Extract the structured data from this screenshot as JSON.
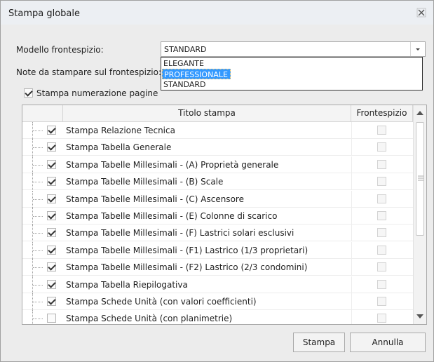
{
  "window": {
    "title": "Stampa globale",
    "close_icon": "close-icon"
  },
  "form": {
    "modello_label": "Modello frontespizio:",
    "modello_value": "STANDARD",
    "note_label": "Note da stampare sul frontespizio:",
    "numerazione_label": "Stampa numerazione pagine",
    "numerazione_checked": true
  },
  "dropdown": {
    "options": [
      "ELEGANTE",
      "PROFESSIONALE",
      "STANDARD"
    ],
    "selected": "PROFESSIONALE"
  },
  "grid": {
    "headers": [
      "Titolo stampa",
      "Frontespizio"
    ],
    "rows": [
      {
        "title": "Stampa Relazione Tecnica",
        "checked": true
      },
      {
        "title": "Stampa Tabella Generale",
        "checked": true
      },
      {
        "title": "Stampa Tabelle Millesimali - (A) Proprietà generale",
        "checked": true
      },
      {
        "title": "Stampa Tabelle Millesimali - (B) Scale",
        "checked": true
      },
      {
        "title": "Stampa Tabelle Millesimali - (C) Ascensore",
        "checked": true
      },
      {
        "title": "Stampa Tabelle Millesimali - (E) Colonne di scarico",
        "checked": true
      },
      {
        "title": "Stampa Tabelle Millesimali - (F) Lastrici solari esclusivi",
        "checked": true
      },
      {
        "title": "Stampa Tabelle Millesimali - (F1) Lastrico (1/3 proprietari)",
        "checked": true
      },
      {
        "title": "Stampa Tabelle Millesimali - (F2) Lastrico (2/3 condomini)",
        "checked": true
      },
      {
        "title": "Stampa Tabella Riepilogativa",
        "checked": true
      },
      {
        "title": "Stampa Schede Unità (con valori coefficienti)",
        "checked": true
      },
      {
        "title": "Stampa Schede Unità (con planimetrie)",
        "checked": false
      }
    ]
  },
  "buttons": {
    "stampa": "Stampa",
    "annulla": "Annulla"
  }
}
